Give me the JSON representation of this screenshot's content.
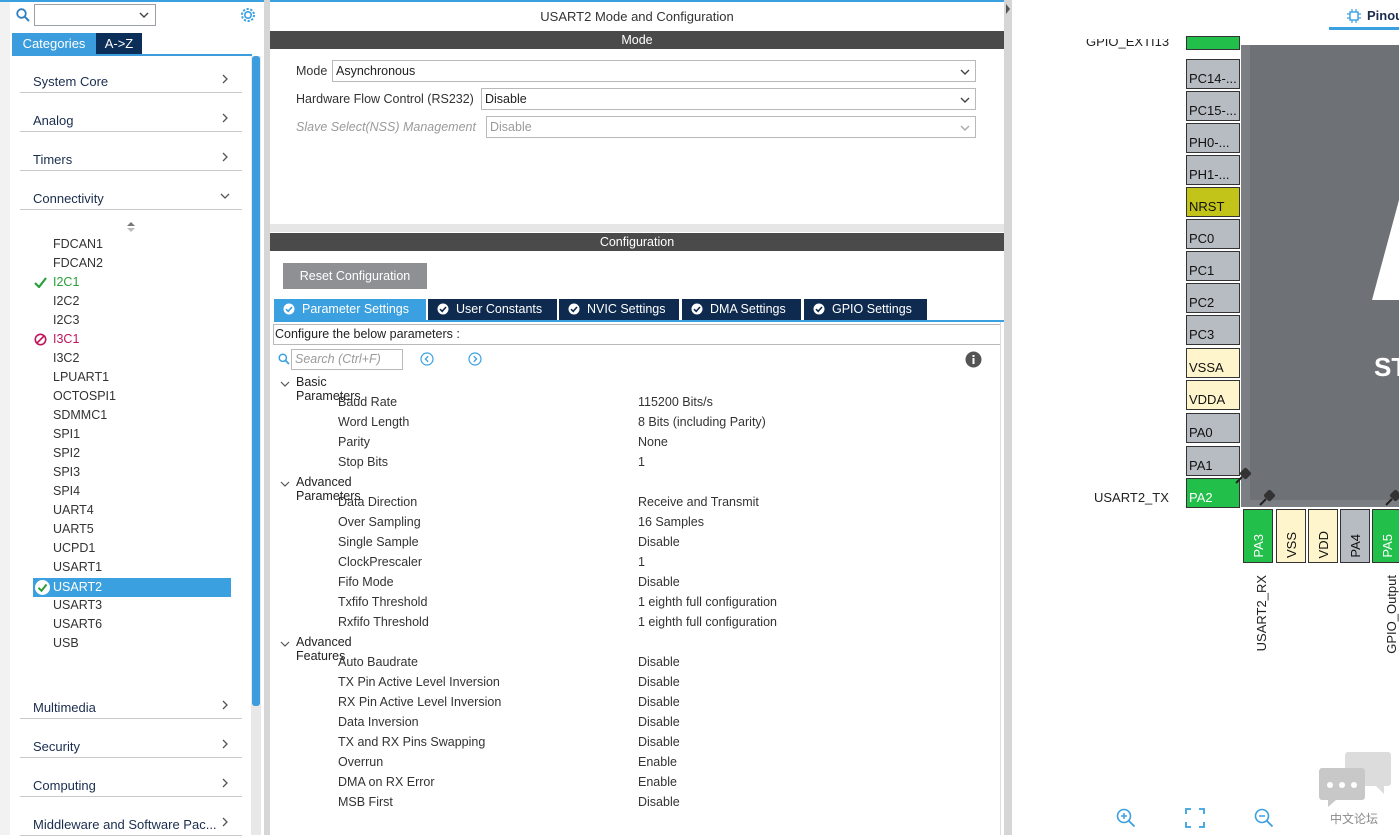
{
  "left_panel": {
    "tabs": {
      "categories": "Categories",
      "az": "A->Z"
    },
    "categories": [
      {
        "label": "System Core"
      },
      {
        "label": "Analog"
      },
      {
        "label": "Timers"
      },
      {
        "label": "Connectivity"
      }
    ],
    "connectivity_items": [
      {
        "label": "FDCAN1"
      },
      {
        "label": "FDCAN2"
      },
      {
        "label": "I2C1",
        "status": "ok"
      },
      {
        "label": "I2C2"
      },
      {
        "label": "I2C3"
      },
      {
        "label": "I3C1",
        "status": "disabled"
      },
      {
        "label": "I3C2"
      },
      {
        "label": "LPUART1"
      },
      {
        "label": "OCTOSPI1"
      },
      {
        "label": "SDMMC1"
      },
      {
        "label": "SPI1"
      },
      {
        "label": "SPI2"
      },
      {
        "label": "SPI3"
      },
      {
        "label": "SPI4"
      },
      {
        "label": "UART4"
      },
      {
        "label": "UART5"
      },
      {
        "label": "UCPD1"
      },
      {
        "label": "USART1"
      },
      {
        "label": "USART2",
        "status": "ok",
        "selected": true
      },
      {
        "label": "USART3"
      },
      {
        "label": "USART6"
      },
      {
        "label": "USB"
      }
    ],
    "bottom_categories": [
      {
        "label": "Multimedia"
      },
      {
        "label": "Security"
      },
      {
        "label": "Computing"
      },
      {
        "label": "Middleware and Software Pac..."
      }
    ]
  },
  "middle": {
    "title": "USART2 Mode and Configuration",
    "mode_header": "Mode",
    "mode_fields": [
      {
        "label": "Mode",
        "value": "Asynchronous"
      },
      {
        "label": "Hardware Flow Control (RS232)",
        "value": "Disable"
      },
      {
        "label": "Slave Select(NSS) Management",
        "value": "Disable",
        "disabled": true
      }
    ],
    "config_header": "Configuration",
    "reset_button": "Reset Configuration",
    "tabs": [
      {
        "label": "Parameter Settings"
      },
      {
        "label": "User Constants"
      },
      {
        "label": "NVIC Settings"
      },
      {
        "label": "DMA Settings"
      },
      {
        "label": "GPIO Settings"
      }
    ],
    "configure_text": "Configure the below parameters :",
    "search_placeholder": "Search (Ctrl+F)",
    "groups": [
      {
        "name": "Basic Parameters",
        "params": [
          {
            "name": "Baud Rate",
            "value": "115200 Bits/s"
          },
          {
            "name": "Word Length",
            "value": "8 Bits (including Parity)"
          },
          {
            "name": "Parity",
            "value": "None"
          },
          {
            "name": "Stop Bits",
            "value": "1"
          }
        ]
      },
      {
        "name": "Advanced Parameters",
        "params": [
          {
            "name": "Data Direction",
            "value": "Receive and Transmit"
          },
          {
            "name": "Over Sampling",
            "value": "16 Samples"
          },
          {
            "name": "Single Sample",
            "value": "Disable"
          },
          {
            "name": "ClockPrescaler",
            "value": "1"
          },
          {
            "name": "Fifo Mode",
            "value": "Disable"
          },
          {
            "name": "Txfifo Threshold",
            "value": "1 eighth full configuration"
          },
          {
            "name": "Rxfifo Threshold",
            "value": "1 eighth full configuration"
          }
        ]
      },
      {
        "name": "Advanced Features",
        "params": [
          {
            "name": "Auto Baudrate",
            "value": "Disable"
          },
          {
            "name": "TX Pin Active Level Inversion",
            "value": "Disable"
          },
          {
            "name": "RX Pin Active Level Inversion",
            "value": "Disable"
          },
          {
            "name": "Data Inversion",
            "value": "Disable"
          },
          {
            "name": "TX and RX Pins Swapping",
            "value": "Disable"
          },
          {
            "name": "Overrun",
            "value": "Enable"
          },
          {
            "name": "DMA on RX Error",
            "value": "Enable"
          },
          {
            "name": "MSB First",
            "value": "Disable"
          }
        ]
      }
    ]
  },
  "pinout": {
    "tab_label": "Pinou",
    "top_label": "GPIO_EXTI13",
    "left_pins": [
      {
        "label": "PC14-...",
        "color": "gray"
      },
      {
        "label": "PC15-...",
        "color": "gray"
      },
      {
        "label": "PH0-...",
        "color": "gray"
      },
      {
        "label": "PH1-...",
        "color": "gray"
      },
      {
        "label": "NRST",
        "color": "yellow"
      },
      {
        "label": "PC0",
        "color": "gray"
      },
      {
        "label": "PC1",
        "color": "gray"
      },
      {
        "label": "PC2",
        "color": "gray"
      },
      {
        "label": "PC3",
        "color": "gray"
      },
      {
        "label": "VSSA",
        "color": "cream"
      },
      {
        "label": "VDDA",
        "color": "cream"
      },
      {
        "label": "PA0",
        "color": "gray"
      },
      {
        "label": "PA1",
        "color": "gray"
      },
      {
        "label": "PA2",
        "color": "green"
      }
    ],
    "bottom_pins": [
      {
        "label": "PA3",
        "color": "green"
      },
      {
        "label": "VSS",
        "color": "cream"
      },
      {
        "label": "VDD",
        "color": "cream"
      },
      {
        "label": "PA4",
        "color": "gray"
      },
      {
        "label": "PA5",
        "color": "green"
      }
    ],
    "pa2_signal": "USART2_TX",
    "pa3_signal": "USART2_RX",
    "pa5_signal": "GPIO_Output",
    "chip_text": "ST",
    "watermark": "中文论坛"
  },
  "colors": {
    "accent": "#3aa0e0",
    "navy": "#0e2a4f",
    "pin_green": "#22c04a",
    "check_green": "#27a03a",
    "disabled_pink": "#c0155a"
  }
}
